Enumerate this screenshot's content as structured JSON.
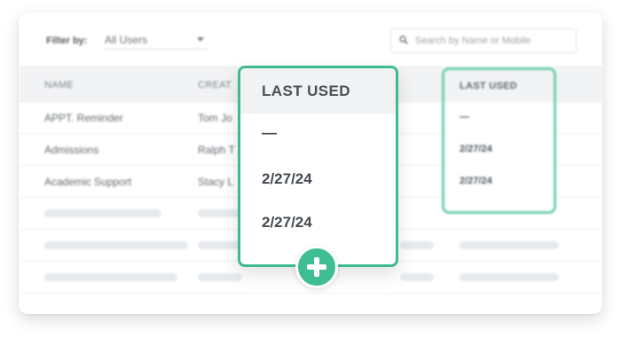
{
  "filter": {
    "label": "Filter by:",
    "value": "All Users"
  },
  "search": {
    "placeholder": "Search by Name or Mobile"
  },
  "table": {
    "headers": {
      "name": "NAME",
      "created": "CREAT",
      "last_used": "LAST USED"
    },
    "rows": [
      {
        "name": "APPT. Reminder",
        "created": "Tom Jo",
        "last_used": "—"
      },
      {
        "name": "Admissions",
        "created": "Ralph T",
        "last_used": "2/27/24"
      },
      {
        "name": "Academic Support",
        "created": "Stacy L",
        "last_used": "2/27/24"
      }
    ]
  },
  "popup": {
    "title": "LAST USED",
    "values": [
      "—",
      "2/27/24",
      "2/27/24"
    ]
  },
  "colors": {
    "accent": "#3dbb8e",
    "highlight": "#6dd0ae"
  },
  "icons": {
    "add": "plus-icon",
    "search": "search-icon",
    "dropdown": "chevron-down-icon"
  }
}
